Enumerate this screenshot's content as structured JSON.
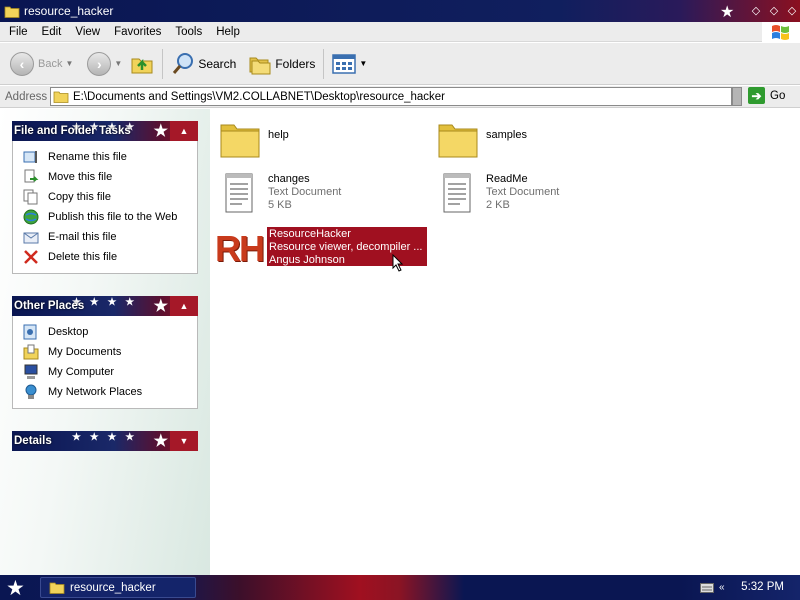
{
  "window": {
    "title": "resource_hacker"
  },
  "menu": {
    "items": [
      "File",
      "Edit",
      "View",
      "Favorites",
      "Tools",
      "Help"
    ]
  },
  "toolbar": {
    "back_label": "Back",
    "search_label": "Search",
    "folders_label": "Folders"
  },
  "address": {
    "label": "Address",
    "value": "E:\\Documents and Settings\\VM2.COLLABNET\\Desktop\\resource_hacker",
    "go_label": "Go"
  },
  "tasks": {
    "title": "File and Folder Tasks",
    "items": [
      {
        "label": "Rename this file",
        "icon": "rename-icon"
      },
      {
        "label": "Move this file",
        "icon": "move-icon"
      },
      {
        "label": "Copy this file",
        "icon": "copy-icon"
      },
      {
        "label": "Publish this file to the Web",
        "icon": "globe-icon"
      },
      {
        "label": "E-mail this file",
        "icon": "email-icon"
      },
      {
        "label": "Delete this file",
        "icon": "delete-icon"
      }
    ]
  },
  "places": {
    "title": "Other Places",
    "items": [
      {
        "label": "Desktop",
        "icon": "desktop-icon"
      },
      {
        "label": "My Documents",
        "icon": "my-documents-icon"
      },
      {
        "label": "My Computer",
        "icon": "my-computer-icon"
      },
      {
        "label": "My Network Places",
        "icon": "network-places-icon"
      }
    ]
  },
  "details": {
    "title": "Details"
  },
  "files": [
    {
      "name": "help",
      "type": "folder"
    },
    {
      "name": "samples",
      "type": "folder"
    },
    {
      "name": "changes",
      "type": "text",
      "desc": "Text Document",
      "size": "5 KB"
    },
    {
      "name": "ReadMe",
      "type": "text",
      "desc": "Text Document",
      "size": "2 KB"
    },
    {
      "name": "ResourceHacker",
      "type": "app",
      "desc": "Resource viewer, decompiler ...",
      "author": "Angus Johnson",
      "selected": true,
      "icon_text": "RH"
    }
  ],
  "taskbar": {
    "window_button": "resource_hacker",
    "clock": "5:32 PM"
  },
  "colors": {
    "accent_red": "#a01020",
    "navy": "#0a1652"
  }
}
